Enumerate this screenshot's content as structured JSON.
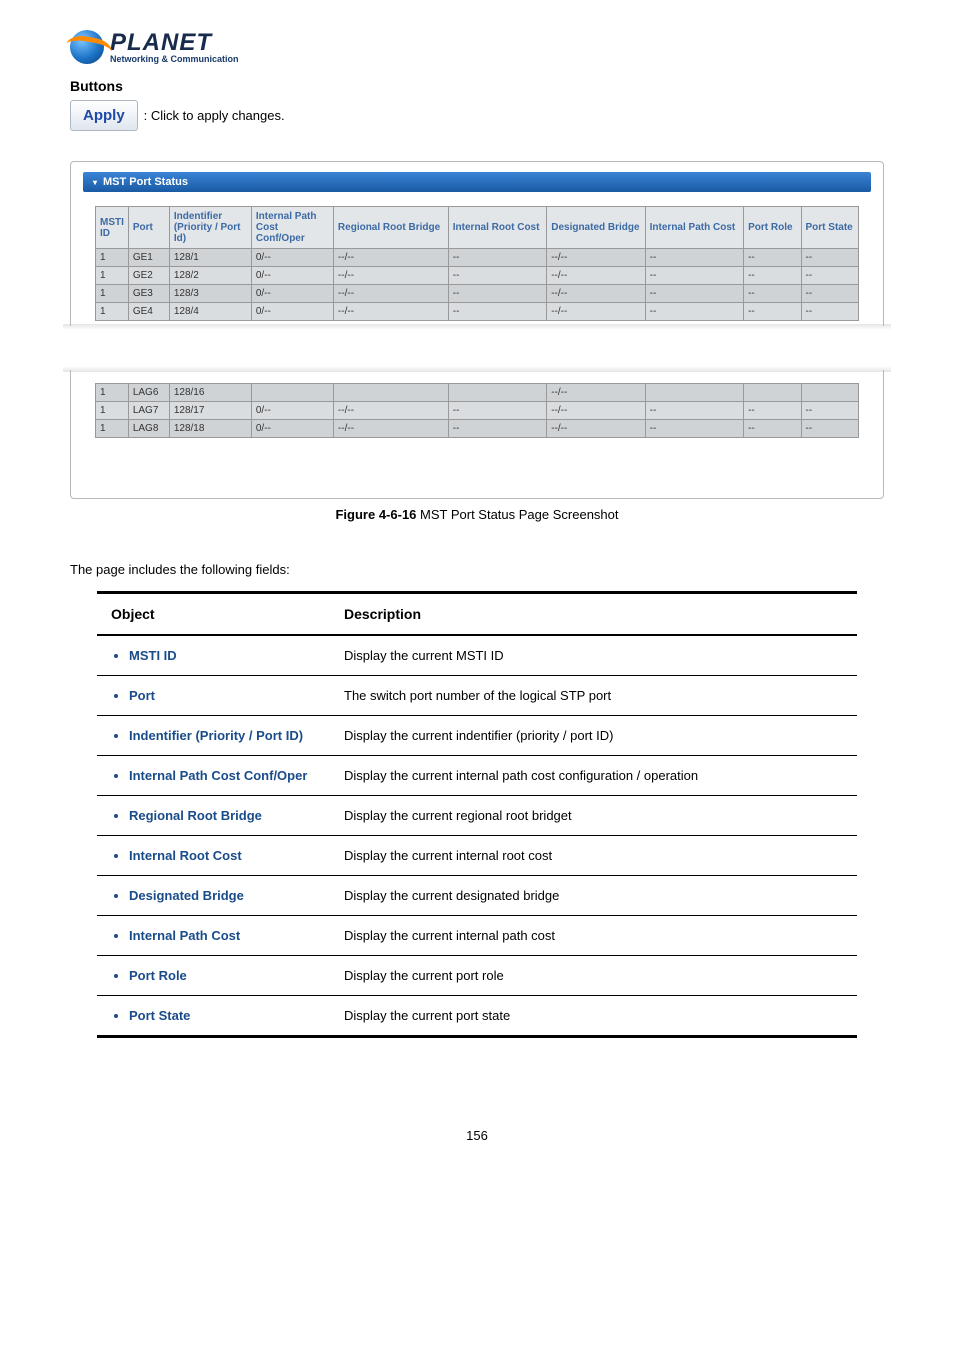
{
  "logo": {
    "brand": "PLANET",
    "tag": "Networking & Communication"
  },
  "buttons_section": {
    "heading": "Buttons",
    "apply_label": "Apply",
    "apply_desc": ": Click to apply changes."
  },
  "mst_panel": {
    "title": "MST Port Status",
    "columns": {
      "msti": "MSTI ID",
      "port": "Port",
      "ident": "Indentifier (Priority / Port Id)",
      "ipc": "Internal Path Cost Conf/Oper",
      "rrb": "Regional Root Bridge",
      "irc": "Internal Root Cost",
      "db": "Designated Bridge",
      "ipc2": "Internal Path Cost",
      "pr": "Port Role",
      "ps": "Port State"
    },
    "rows_top": [
      {
        "msti": "1",
        "port": "GE1",
        "ident": "128/1",
        "ipc": "0/--",
        "rrb": "--/--",
        "irc": "--",
        "db": "--/--",
        "ipc2": "--",
        "pr": "--",
        "ps": "--"
      },
      {
        "msti": "1",
        "port": "GE2",
        "ident": "128/2",
        "ipc": "0/--",
        "rrb": "--/--",
        "irc": "--",
        "db": "--/--",
        "ipc2": "--",
        "pr": "--",
        "ps": "--"
      },
      {
        "msti": "1",
        "port": "GE3",
        "ident": "128/3",
        "ipc": "0/--",
        "rrb": "--/--",
        "irc": "--",
        "db": "--/--",
        "ipc2": "--",
        "pr": "--",
        "ps": "--"
      },
      {
        "msti": "1",
        "port": "GE4",
        "ident": "128/4",
        "ipc": "0/--",
        "rrb": "--/--",
        "irc": "--",
        "db": "--/--",
        "ipc2": "--",
        "pr": "--",
        "ps": "--"
      }
    ],
    "rows_bottom": [
      {
        "msti": "1",
        "port": "LAG6",
        "ident": "128/16",
        "ipc": "",
        "rrb": "",
        "irc": "",
        "db": "--/--",
        "ipc2": "",
        "pr": "",
        "ps": ""
      },
      {
        "msti": "1",
        "port": "LAG7",
        "ident": "128/17",
        "ipc": "0/--",
        "rrb": "--/--",
        "irc": "--",
        "db": "--/--",
        "ipc2": "--",
        "pr": "--",
        "ps": "--"
      },
      {
        "msti": "1",
        "port": "LAG8",
        "ident": "128/18",
        "ipc": "0/--",
        "rrb": "--/--",
        "irc": "--",
        "db": "--/--",
        "ipc2": "--",
        "pr": "--",
        "ps": "--"
      }
    ]
  },
  "figure_caption": {
    "bold": "Figure 4-6-16",
    "rest": " MST Port Status Page Screenshot"
  },
  "fields_intro": "The page includes the following fields:",
  "fields_table": {
    "head_obj": "Object",
    "head_desc": "Description",
    "rows": [
      {
        "obj": "MSTI ID",
        "desc": "Display the current MSTI ID"
      },
      {
        "obj": "Port",
        "desc": "The switch port number of the logical STP port"
      },
      {
        "obj": "Indentifier (Priority / Port ID)",
        "desc": "Display the current indentifier (priority / port ID)"
      },
      {
        "obj": "Internal Path Cost Conf/Oper",
        "desc": "Display the current internal path cost configuration / operation"
      },
      {
        "obj": "Regional Root Bridge",
        "desc": "Display the current regional root bridget"
      },
      {
        "obj": "Internal Root Cost",
        "desc": "Display the current internal root cost"
      },
      {
        "obj": "Designated Bridge",
        "desc": "Display the current designated bridge"
      },
      {
        "obj": "Internal Path Cost",
        "desc": "Display the current internal path cost"
      },
      {
        "obj": "Port Role",
        "desc": "Display the current port role"
      },
      {
        "obj": "Port State",
        "desc": "Display the current port state"
      }
    ]
  },
  "page_number": "156"
}
